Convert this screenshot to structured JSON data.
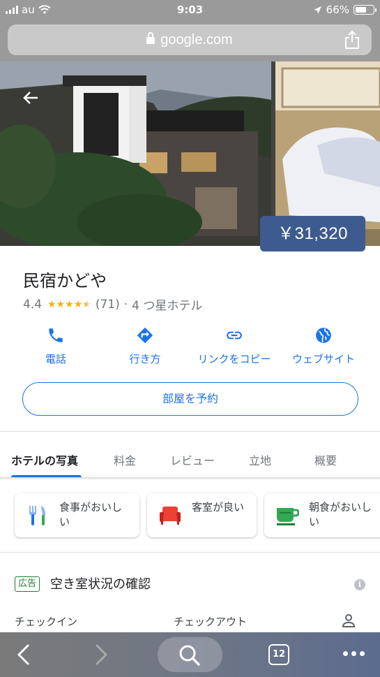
{
  "status_bar": {
    "carrier": "au",
    "time": "9:03",
    "battery_percent": "66%",
    "battery_level": 0.66
  },
  "browser": {
    "url": "google.com"
  },
  "hotel": {
    "price": "￥31,320",
    "name": "民宿かどや",
    "rating": "4.4",
    "rating_value": 4.4,
    "review_count": "(71)",
    "separator": "·",
    "category": "4 つ星ホテル"
  },
  "actions": [
    {
      "label": "電話",
      "icon": "phone-icon"
    },
    {
      "label": "行き方",
      "icon": "directions-icon"
    },
    {
      "label": "リンクをコピー",
      "icon": "link-icon"
    },
    {
      "label": "ウェブサイト",
      "icon": "globe-icon"
    }
  ],
  "book_button": "部屋を予約",
  "tabs": [
    {
      "label": "ホテルの写真",
      "active": true
    },
    {
      "label": "料金",
      "active": false
    },
    {
      "label": "レビュー",
      "active": false
    },
    {
      "label": "立地",
      "active": false
    },
    {
      "label": "概要",
      "active": false
    }
  ],
  "highlights": [
    {
      "label": "食事がおいしい",
      "icon": "cutlery-icon"
    },
    {
      "label": "客室が良い",
      "icon": "armchair-icon"
    },
    {
      "label": "朝食がおいしい",
      "icon": "coffee-cup-icon"
    }
  ],
  "ad": {
    "badge": "広告",
    "title": "空き室状況の確認",
    "info": "i",
    "checkin_label": "チェックイン",
    "checkout_label": "チェックアウト"
  },
  "toolbar": {
    "tab_count": "12"
  },
  "colors": {
    "accent": "#1a73e8",
    "price_badge": "#3d5b8f",
    "star": "#f5b400",
    "ad_green": "#188038"
  }
}
